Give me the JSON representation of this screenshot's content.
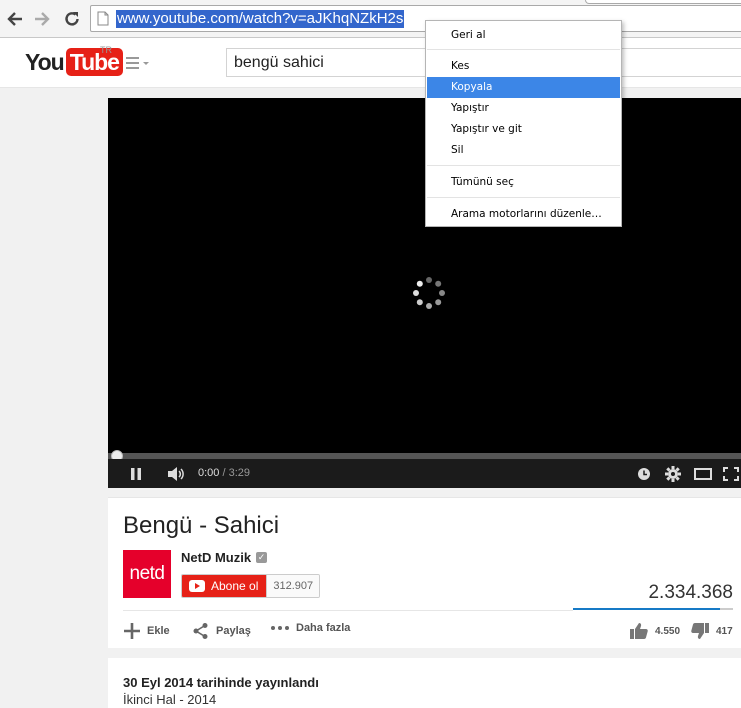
{
  "browser": {
    "url": "www.youtube.com/watch?v=aJKhqNZkH2s",
    "back_icon": "arrow-left-icon",
    "forward_icon": "arrow-right-icon",
    "reload_icon": "reload-icon"
  },
  "header": {
    "logo_you": "You",
    "logo_tube": "Tube",
    "country": "TR",
    "search_value": "bengü sahici"
  },
  "player": {
    "current_time": "0:00",
    "duration": " / 3:29",
    "progress": 0
  },
  "video": {
    "title": "Bengü - Sahici",
    "channel_name": "NetD Muzik",
    "channel_avatar_text": "netd",
    "subscribe_label": "Abone ol",
    "subscriber_count": "312.907",
    "view_count": "2.334.368",
    "like_ratio": 0.92,
    "add_label": "Ekle",
    "share_label": "Paylaş",
    "more_label": "Daha fazla",
    "likes": "4.550",
    "dislikes": "417"
  },
  "description": {
    "published": "30 Eyl 2014 tarihinde yayınlandı",
    "line1": "İkinci Hal - 2014"
  },
  "context_menu": {
    "items": [
      "Geri al",
      "Kes",
      "Kopyala",
      "Yapıştır",
      "Yapıştır ve git",
      "Sil",
      "Tümünü seç",
      "Arama motorlarını düzenle…"
    ],
    "highlighted": "Kopyala"
  },
  "colors": {
    "yt_red": "#e62117",
    "highlight": "#3c86e7",
    "url_selection": "#3366cc"
  }
}
